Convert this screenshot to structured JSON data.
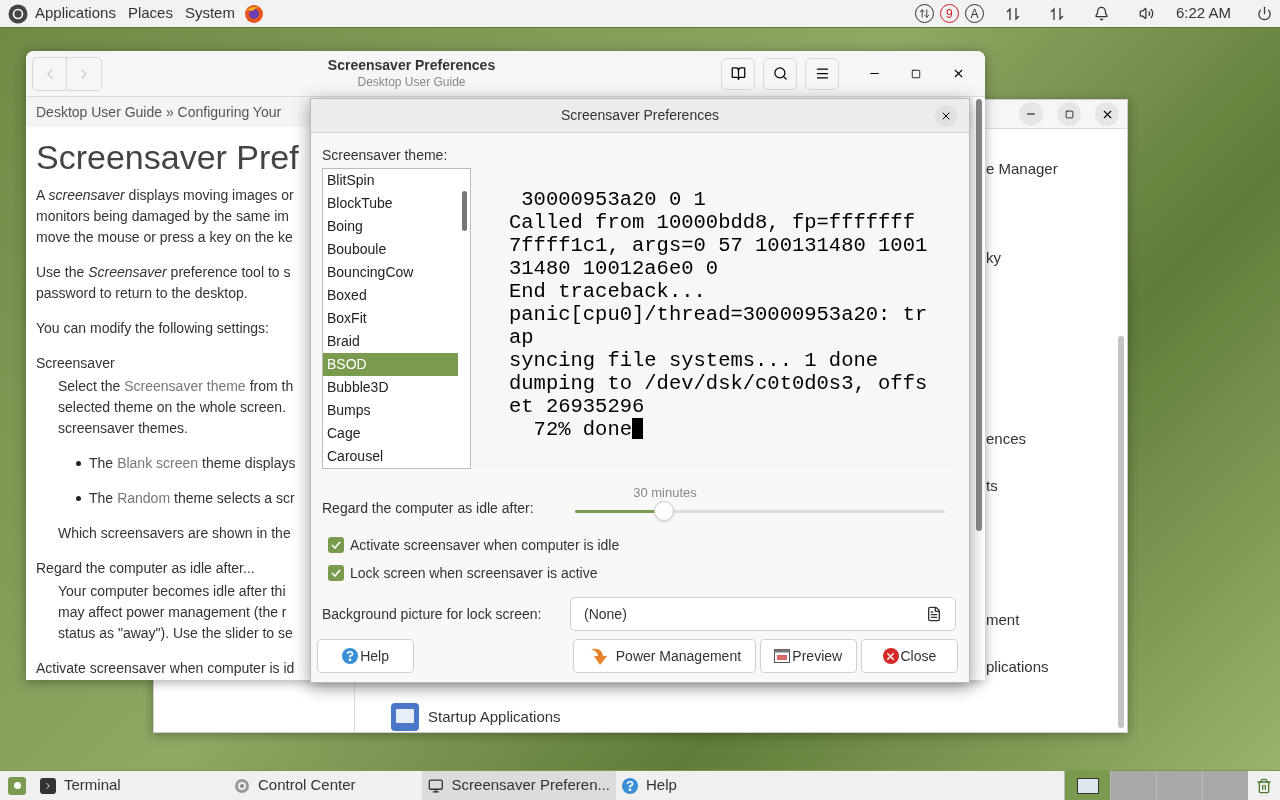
{
  "top_panel": {
    "menus": [
      "Applications",
      "Places",
      "System"
    ],
    "tray_badges": [
      {
        "text": "9",
        "kind": "alert"
      },
      {
        "text": "A",
        "kind": "plain"
      }
    ],
    "clock": "6:22 AM"
  },
  "help_window": {
    "title": "Screensaver Preferences",
    "subtitle": "Desktop User Guide",
    "breadcrumb": "Desktop User Guide » Configuring Your",
    "heading": "Screensaver Pref",
    "blocks": [
      {
        "kind": "para",
        "lines": [
          [
            {
              "text": "A *screensaver* displays moving images or",
              "kind": "plain"
            }
          ],
          [
            {
              "text": "monitors being damaged by the same im",
              "kind": "plain"
            }
          ],
          [
            {
              "text": "move the mouse or press a key on the ke",
              "kind": "plain"
            }
          ]
        ]
      },
      {
        "kind": "para",
        "lines": [
          [
            {
              "text": "Use the *Screensaver* preference tool to s",
              "kind": "plain"
            }
          ],
          [
            {
              "text": "password to return to the desktop.",
              "kind": "plain"
            }
          ]
        ]
      },
      {
        "kind": "para",
        "lines": [
          [
            {
              "text": "You can modify the following settings:",
              "kind": "plain"
            }
          ]
        ]
      },
      {
        "kind": "term",
        "lines": [
          [
            {
              "text": "Screensaver",
              "kind": "plain"
            }
          ]
        ]
      },
      {
        "kind": "desc",
        "lines": [
          [
            {
              "text": "Select the",
              "kind": "plain"
            },
            {
              "text": "Screensaver theme",
              "kind": "link"
            },
            {
              "text": "from th",
              "kind": "plain"
            }
          ],
          [
            {
              "text": "selected theme on the whole screen.",
              "kind": "plain"
            }
          ],
          [
            {
              "text": "screensaver themes.",
              "kind": "plain"
            }
          ]
        ]
      },
      {
        "kind": "bullet",
        "lines": [
          [
            {
              "text": "The",
              "kind": "plain"
            },
            {
              "text": "Blank screen",
              "kind": "link"
            },
            {
              "text": "theme displays",
              "kind": "plain"
            }
          ]
        ]
      },
      {
        "kind": "bullet",
        "lines": [
          [
            {
              "text": "The",
              "kind": "plain"
            },
            {
              "text": "Random",
              "kind": "link"
            },
            {
              "text": "theme selects a scr",
              "kind": "plain"
            }
          ]
        ]
      },
      {
        "kind": "desc",
        "lines": [
          [
            {
              "text": "Which screensavers are shown in the",
              "kind": "plain"
            }
          ]
        ]
      },
      {
        "kind": "term",
        "lines": [
          [
            {
              "text": "Regard the computer as idle after...",
              "kind": "plain"
            }
          ]
        ]
      },
      {
        "kind": "desc",
        "lines": [
          [
            {
              "text": "Your computer becomes idle after thi",
              "kind": "plain"
            }
          ],
          [
            {
              "text": "may affect power management (the r",
              "kind": "plain"
            }
          ],
          [
            {
              "text": "status as \"away\"). Use the slider to se",
              "kind": "plain"
            }
          ]
        ]
      },
      {
        "kind": "term",
        "lines": [
          [
            {
              "text": "Activate screensaver when computer is id",
              "kind": "plain"
            }
          ]
        ]
      }
    ]
  },
  "control_center": {
    "items": [
      "e Manager",
      "ky",
      "ences",
      "ts",
      "ment",
      "plications"
    ],
    "startup_item": "Startup Applications"
  },
  "dialog": {
    "title": "Screensaver Preferences",
    "theme_label": "Screensaver theme:",
    "themes": [
      {
        "label": "BlitSpin",
        "selected": false
      },
      {
        "label": "BlockTube",
        "selected": false
      },
      {
        "label": "Boing",
        "selected": false
      },
      {
        "label": "Bouboule",
        "selected": false
      },
      {
        "label": "BouncingCow",
        "selected": false
      },
      {
        "label": "Boxed",
        "selected": false
      },
      {
        "label": "BoxFit",
        "selected": false
      },
      {
        "label": "Braid",
        "selected": false
      },
      {
        "label": "BSOD",
        "selected": true
      },
      {
        "label": "Bubble3D",
        "selected": false
      },
      {
        "label": "Bumps",
        "selected": false
      },
      {
        "label": "Cage",
        "selected": false
      },
      {
        "label": "Carousel",
        "selected": false
      }
    ],
    "preview_lines": [
      " 30000953a20 0 1",
      "Called from 10000bdd8, fp=fffffff",
      "7ffff1c1, args=0 57 100131480 1001",
      "31480 10012a6e0 0",
      "End traceback...",
      "panic[cpu0]/thread=30000953a20: tr",
      "ap",
      "syncing file systems... 1 done",
      "dumping to /dev/dsk/c0t0d0s3, offs",
      "et 26935296",
      "  72% done"
    ],
    "idle": {
      "label": "Regard the computer as idle after:",
      "reading": "30 minutes",
      "level": 0.24
    },
    "checkboxes": [
      {
        "label": "Activate screensaver when computer is idle",
        "checked": true
      },
      {
        "label": "Lock screen when screensaver is active",
        "checked": true
      }
    ],
    "background": {
      "label": "Background picture for lock screen:",
      "value": "(None)"
    },
    "buttons": [
      {
        "label": "Help",
        "kind": "help"
      },
      {
        "label": "Power Management",
        "kind": "power"
      },
      {
        "label": "Preview",
        "kind": "preview"
      },
      {
        "label": "Close",
        "kind": "close"
      }
    ]
  },
  "taskbar": {
    "tasks": [
      {
        "label": "Terminal",
        "kind": "terminal",
        "selected": false
      },
      {
        "label": "Control Center",
        "kind": "control",
        "selected": false
      },
      {
        "label": "Screensaver Preferen...",
        "kind": "screensaver",
        "selected": true
      },
      {
        "label": "Help",
        "kind": "help",
        "selected": false
      }
    ],
    "workspaces": [
      {
        "selected": true
      },
      {
        "selected": false
      },
      {
        "selected": false
      },
      {
        "selected": false
      }
    ]
  }
}
